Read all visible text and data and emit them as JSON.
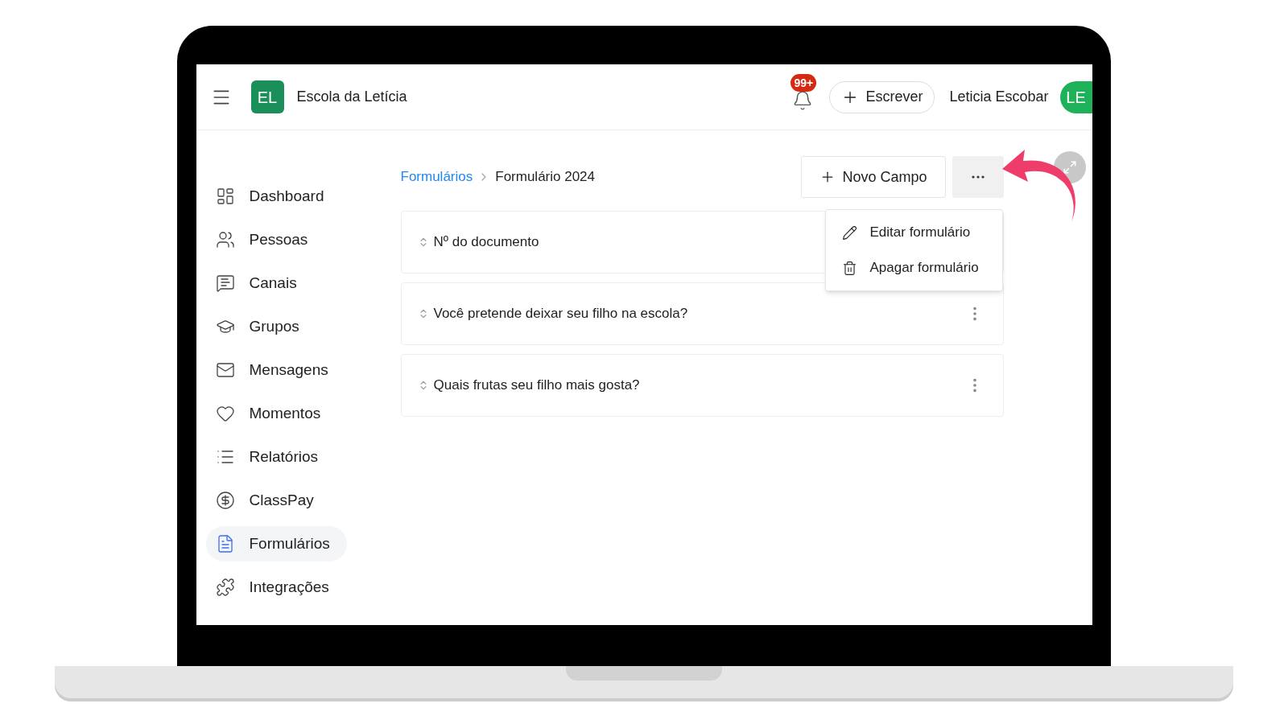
{
  "header": {
    "school_initials": "EL",
    "school_name": "Escola da Letícia",
    "notifications": "99+",
    "compose": "Escrever",
    "user_name": "Leticia Escobar",
    "user_initials": "LE"
  },
  "sidebar": {
    "items": [
      {
        "label": "Dashboard",
        "selected": false
      },
      {
        "label": "Pessoas",
        "selected": false
      },
      {
        "label": "Canais",
        "selected": false
      },
      {
        "label": "Grupos",
        "selected": false
      },
      {
        "label": "Mensagens",
        "selected": false
      },
      {
        "label": "Momentos",
        "selected": false
      },
      {
        "label": "Relatórios",
        "selected": false
      },
      {
        "label": "ClassPay",
        "selected": false
      },
      {
        "label": "Formulários",
        "selected": true
      },
      {
        "label": "Integrações",
        "selected": false
      }
    ]
  },
  "breadcrumb": [
    {
      "label": "Formulários",
      "link": true
    },
    {
      "label": "Formulário 2024",
      "link": false
    }
  ],
  "new_field_button": "Novo Campo",
  "menu": {
    "open": true,
    "items": [
      {
        "label": "Editar formulário"
      },
      {
        "label": "Apagar formulário"
      }
    ]
  },
  "fields": [
    {
      "label": "Nº do documento",
      "menu_icon": false
    },
    {
      "label": "Você pretende deixar seu filho na escola?",
      "menu_icon": true
    },
    {
      "label": "Quais frutas seu filho mais gosta?",
      "menu_icon": true
    }
  ]
}
